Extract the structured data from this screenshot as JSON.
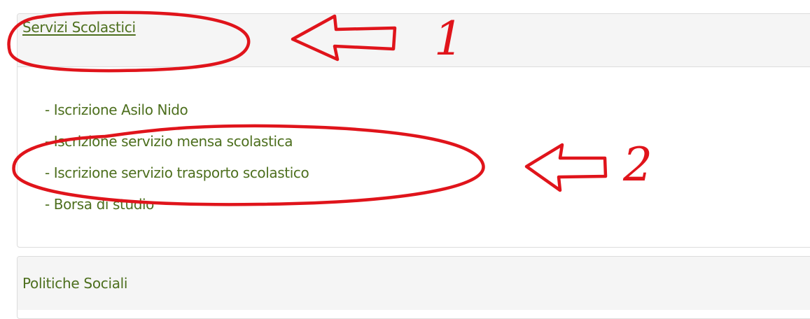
{
  "panels": [
    {
      "title": "Servizi Scolastici",
      "items": [
        "- Iscrizione Asilo Nido",
        "- Iscrizione servizio mensa scolastica",
        "- Iscrizione servizio trasporto scolastico",
        "- Borsa di studio"
      ]
    },
    {
      "title": "Politiche Sociali"
    }
  ],
  "annotations": {
    "marker_1": "1",
    "marker_2": "2",
    "color": "#e0141b"
  },
  "colors": {
    "link_green": "#4d6f1e",
    "panel_heading_bg": "#f5f5f5",
    "border": "#dcdcdc"
  }
}
